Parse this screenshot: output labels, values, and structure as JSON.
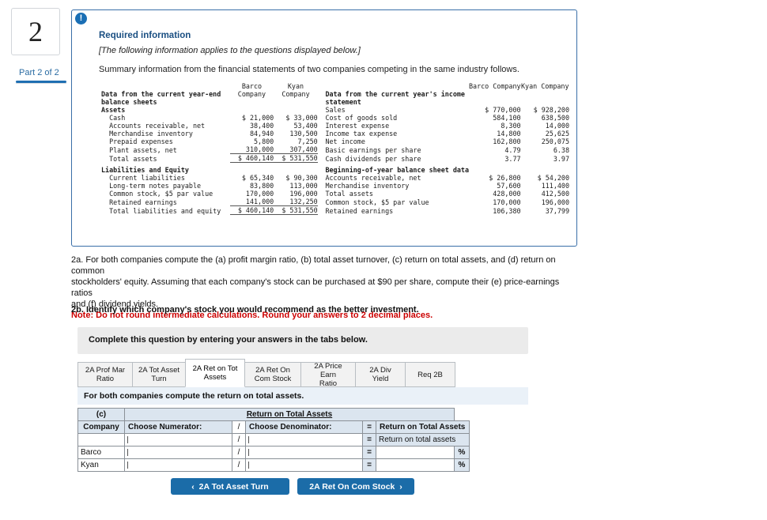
{
  "left_rail": {
    "question_number": "2",
    "part_label": "Part 2 of 2"
  },
  "panel": {
    "alert_icon": "!",
    "title": "Required information",
    "subtitle": "[The following information applies to the questions displayed below.]",
    "body": "Summary information from the financial statements of two companies competing in the same industry follows."
  },
  "financials": {
    "left": {
      "col_headers": [
        "",
        "Barco\nCompany",
        "Kyan\nCompany"
      ],
      "barco_header_l1": "Barco",
      "barco_header_l2": "Company",
      "kyan_header_l1": "Kyan",
      "kyan_header_l2": "Company",
      "section1_l1": "Data from the current year-end",
      "section1_l2": "balance sheets",
      "rows": [
        {
          "label": "Assets",
          "barco": "",
          "kyan": "",
          "style": "bold"
        },
        {
          "label": "  Cash",
          "barco": "$ 21,000",
          "kyan": "$ 33,000",
          "style": "plain"
        },
        {
          "label": "  Accounts receivable, net",
          "barco": "38,400",
          "kyan": "53,400",
          "style": "plain"
        },
        {
          "label": "  Merchandise inventory",
          "barco": "84,940",
          "kyan": "130,500",
          "style": "plain"
        },
        {
          "label": "  Prepaid expenses",
          "barco": "5,800",
          "kyan": "7,250",
          "style": "plain"
        },
        {
          "label": "  Plant assets, net",
          "barco": "310,000",
          "kyan": "307,400",
          "style": "plain"
        },
        {
          "label": "  Total assets",
          "barco": "$ 460,140",
          "kyan": "$ 531,550",
          "style": "total"
        },
        {
          "label": "Liabilities and Equity",
          "barco": "",
          "kyan": "",
          "style": "bold"
        },
        {
          "label": "  Current liabilities",
          "barco": "$ 65,340",
          "kyan": "$ 90,300",
          "style": "plain"
        },
        {
          "label": "  Long-term notes payable",
          "barco": "83,800",
          "kyan": "113,000",
          "style": "plain"
        },
        {
          "label": "  Common stock, $5 par value",
          "barco": "170,000",
          "kyan": "196,000",
          "style": "plain"
        },
        {
          "label": "  Retained earnings",
          "barco": "141,000",
          "kyan": "132,250",
          "style": "plain"
        },
        {
          "label": "  Total liabilities and equity",
          "barco": "$ 460,140",
          "kyan": "$ 531,550",
          "style": "total"
        }
      ]
    },
    "right": {
      "barco_header": "Barco Company",
      "kyan_header": "Kyan Company",
      "section1_l1": "Data from the current year's income",
      "section1_l2": "statement",
      "section2": "Beginning-of-year balance sheet data",
      "rows": [
        {
          "label": "Sales",
          "barco": "$ 770,000",
          "kyan": "$ 928,200",
          "style": "plain"
        },
        {
          "label": "Cost of goods sold",
          "barco": "584,100",
          "kyan": "638,500",
          "style": "plain"
        },
        {
          "label": "Interest expense",
          "barco": "8,300",
          "kyan": "14,000",
          "style": "plain"
        },
        {
          "label": "Income tax expense",
          "barco": "14,800",
          "kyan": "25,625",
          "style": "plain"
        },
        {
          "label": "Net income",
          "barco": "162,800",
          "kyan": "250,075",
          "style": "plain"
        },
        {
          "label": "Basic earnings per share",
          "barco": "4.79",
          "kyan": "6.38",
          "style": "plain"
        },
        {
          "label": "Cash dividends per share",
          "barco": "3.77",
          "kyan": "3.97",
          "style": "plain"
        },
        {
          "label": "Accounts receivable, net",
          "barco": "$ 26,800",
          "kyan": "$ 54,200",
          "style": "plain"
        },
        {
          "label": "Merchandise inventory",
          "barco": "57,600",
          "kyan": "111,400",
          "style": "plain"
        },
        {
          "label": "Total assets",
          "barco": "428,000",
          "kyan": "412,500",
          "style": "plain"
        },
        {
          "label": "Common stock, $5 par value",
          "barco": "170,000",
          "kyan": "196,000",
          "style": "plain"
        },
        {
          "label": "Retained earnings",
          "barco": "106,380",
          "kyan": "37,799",
          "style": "plain"
        }
      ]
    }
  },
  "question": {
    "part_a_line1": "2a. For both companies compute the (a) profit margin ratio, (b) total asset turnover, (c) return on total assets, and (d) return on common",
    "part_a_line2": "stockholders' equity. Assuming that each company's stock can be purchased at $90 per share, compute their (e) price-earnings ratios",
    "part_a_line3": "and (f) dividend yields.",
    "note": "Note: Do not round intermediate calculations. Round your answers to 2 decimal places.",
    "part_b": "2b. Identify which company's stock you would recommend as the better investment."
  },
  "complete_banner": "Complete this question by entering your answers in the tabs below.",
  "tabs": [
    {
      "label": "2A Prof Mar\nRatio",
      "active": false,
      "width_class": "w1"
    },
    {
      "label": "2A Tot Asset\nTurn",
      "active": false,
      "width_class": "w2"
    },
    {
      "label": "2A Ret on Tot\nAssets",
      "active": true,
      "width_class": "w3"
    },
    {
      "label": "2A Ret On\nCom Stock",
      "active": false,
      "width_class": "w4"
    },
    {
      "label": "2A Price Earn\nRatio",
      "active": false,
      "width_class": "w5"
    },
    {
      "label": "2A Div Yield",
      "active": false,
      "width_class": "w6"
    },
    {
      "label": "Req 2B",
      "active": false,
      "width_class": "w7"
    }
  ],
  "instruction": "For both companies compute the return on total assets.",
  "answer_grid": {
    "label_c": "(c)",
    "title": "Return on Total Assets",
    "col_company": "Company",
    "col_numerator": "Choose Numerator:",
    "col_slash": "/",
    "col_denominator": "Choose Denominator:",
    "col_equals": "=",
    "col_result": "Return on Total Assets",
    "result_sub": "Return on total assets",
    "rows": [
      {
        "company": "",
        "numerator": "",
        "denominator": "",
        "result": "",
        "pct": ""
      },
      {
        "company": "Barco",
        "numerator": "",
        "denominator": "",
        "result": "",
        "pct": "%"
      },
      {
        "company": "Kyan",
        "numerator": "",
        "denominator": "",
        "result": "",
        "pct": "%"
      }
    ]
  },
  "nav": {
    "prev_arrow": "‹",
    "prev_label": "2A Tot Asset Turn",
    "next_label": "2A Ret On Com Stock",
    "next_arrow": "›"
  },
  "colors": {
    "accent": "#1b6ca8",
    "panel_border": "#3a6fa8",
    "note_red": "#cc0000",
    "grid_header": "#dbe5ef"
  }
}
